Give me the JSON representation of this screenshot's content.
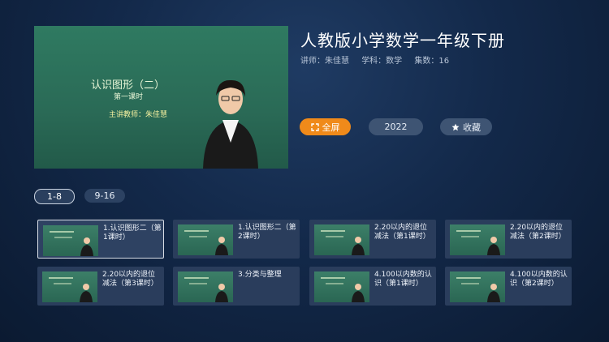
{
  "player": {
    "board_title": "认识图形（二）",
    "board_subtitle": "第一课时",
    "board_teacher": "主讲教师：朱佳慧"
  },
  "course": {
    "title": "人教版小学数学一年级下册",
    "teacher": "讲师：朱佳慧",
    "subject": "学科：数学",
    "episodes": "集数：16"
  },
  "actions": {
    "fullscreen": "全屏",
    "year": "2022",
    "favorite": "收藏"
  },
  "ranges": [
    "1-8",
    "9-16"
  ],
  "episodes": [
    {
      "label": "1.认识图形二（第1课时）",
      "active": true
    },
    {
      "label": "1.认识图形二（第2课时）"
    },
    {
      "label": "2.20以内的退位减法（第1课时）"
    },
    {
      "label": "2.20以内的退位减法（第2课时）"
    },
    {
      "label": "2.20以内的退位减法（第3课时）"
    },
    {
      "label": "3.分类与整理"
    },
    {
      "label": "4.100以内数的认识（第1课时）"
    },
    {
      "label": "4.100以内数的认识（第2课时）"
    }
  ],
  "colors": {
    "accent": "#f08a1a",
    "pill": "#3e5473",
    "card": "#2a3d5c"
  }
}
